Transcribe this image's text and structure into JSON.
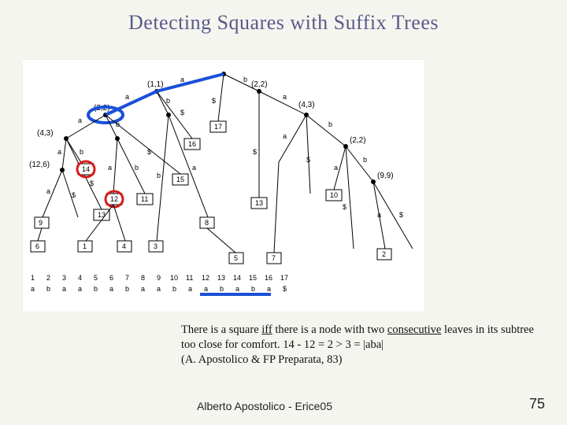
{
  "title": "Detecting Squares with Suffix Trees",
  "tree": {
    "internal_nodes_labels": [
      "(1,1)",
      "(2,2)",
      "(2,2)",
      "(4,3)",
      "(12,6)",
      "(4,3)",
      "(2,2)",
      "(9,9)"
    ],
    "edge_chars": [
      "a",
      "b",
      "$",
      "a",
      "b",
      "$",
      "a",
      "b",
      "$",
      "a",
      "b",
      "$",
      "a",
      "b",
      "a",
      "b",
      "$",
      "a",
      "b",
      "a",
      "b",
      "$"
    ],
    "leaf_boxes": [
      "17",
      "16",
      "15",
      "14",
      "13",
      "12",
      "11",
      "10",
      "9",
      "8",
      "7",
      "6",
      "5",
      "4",
      "3",
      "2",
      "1"
    ]
  },
  "index_row": {
    "positions": [
      "1",
      "2",
      "3",
      "4",
      "5",
      "6",
      "7",
      "8",
      "9",
      "10",
      "11",
      "12",
      "13",
      "14",
      "15",
      "16",
      "17"
    ],
    "chars": [
      "a",
      "b",
      "a",
      "a",
      "b",
      "a",
      "b",
      "a",
      "a",
      "b",
      "a",
      "a",
      "b",
      "a",
      "b",
      "a",
      "$"
    ]
  },
  "theorem": {
    "pre": "There is a square ",
    "iff": "iff",
    "mid": " there is a node with two ",
    "cons": "consecutive",
    "post": " leaves in its  subtree too close for comfort.     14 - 12 = 2 > 3 =  |aba|",
    "cit": "(A. Apostolico & FP Preparata, 83)"
  },
  "footer": {
    "left": "Alberto Apostolico  - Erice05",
    "page": "75"
  },
  "highlight": {
    "ellipse_node": "12",
    "ellipse_node2": "14",
    "blue_line_target": "internal node (2,2) under (1,1)",
    "underline_positions": "12-16"
  }
}
